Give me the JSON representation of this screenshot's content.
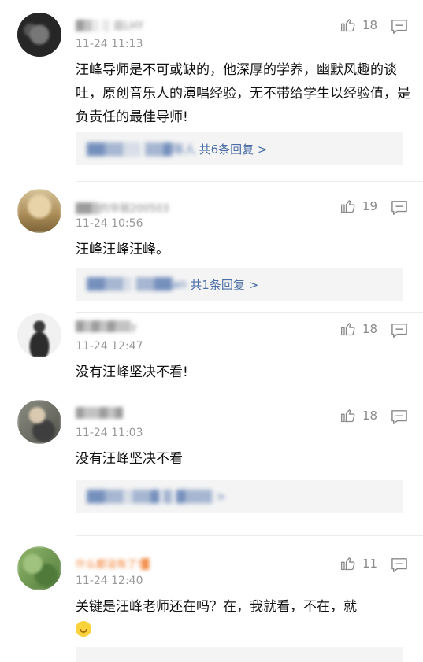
{
  "comments": [
    {
      "name": "▓▒░ ░ 庭LHY",
      "time": "11-24 11:13",
      "likes": "18",
      "text": "汪峰导师是不可或缺的，他深厚的学养，幽默风趣的谈吐，原创音乐人的演唱经验，无不带给学生以经验值，是负责任的最佳导师!",
      "reply_names": "▓▓▒▒░░ ▒▒▓等人",
      "reply_count": "共6条回复 >",
      "avatar_color": "#2d2d2d"
    },
    {
      "name": "▓▓▒的华丽200503",
      "time": "11-24 10:56",
      "likes": "19",
      "text": "汪峰汪峰汪峰。",
      "reply_names": "▓▓▒▒░ ▒▒▓▓an",
      "reply_count": "共1条回复 >",
      "avatar_color": "#c9a872"
    },
    {
      "name": "▓▒▓▒▓▒▒y",
      "time": "11-24 12:47",
      "likes": "18",
      "text": "没有汪峰坚决不看!",
      "avatar_color": "#e5e5e5"
    },
    {
      "name": "▓▒▒▓▒▓",
      "time": "11-24 11:03",
      "likes": "18",
      "text": "没有汪峰坚决不看",
      "reply_names": "▓▓▒▒░▒▒▓ ▒ ▓▒▒▒ >",
      "avatar_color": "#7c7a72"
    },
    {
      "name": "什么都没有了!▓",
      "time": "11-24 12:40",
      "likes": "11",
      "text": "关键是汪峰老师还在吗？在，我就看，不在，就",
      "avatar_color": "#6e9c55"
    }
  ]
}
